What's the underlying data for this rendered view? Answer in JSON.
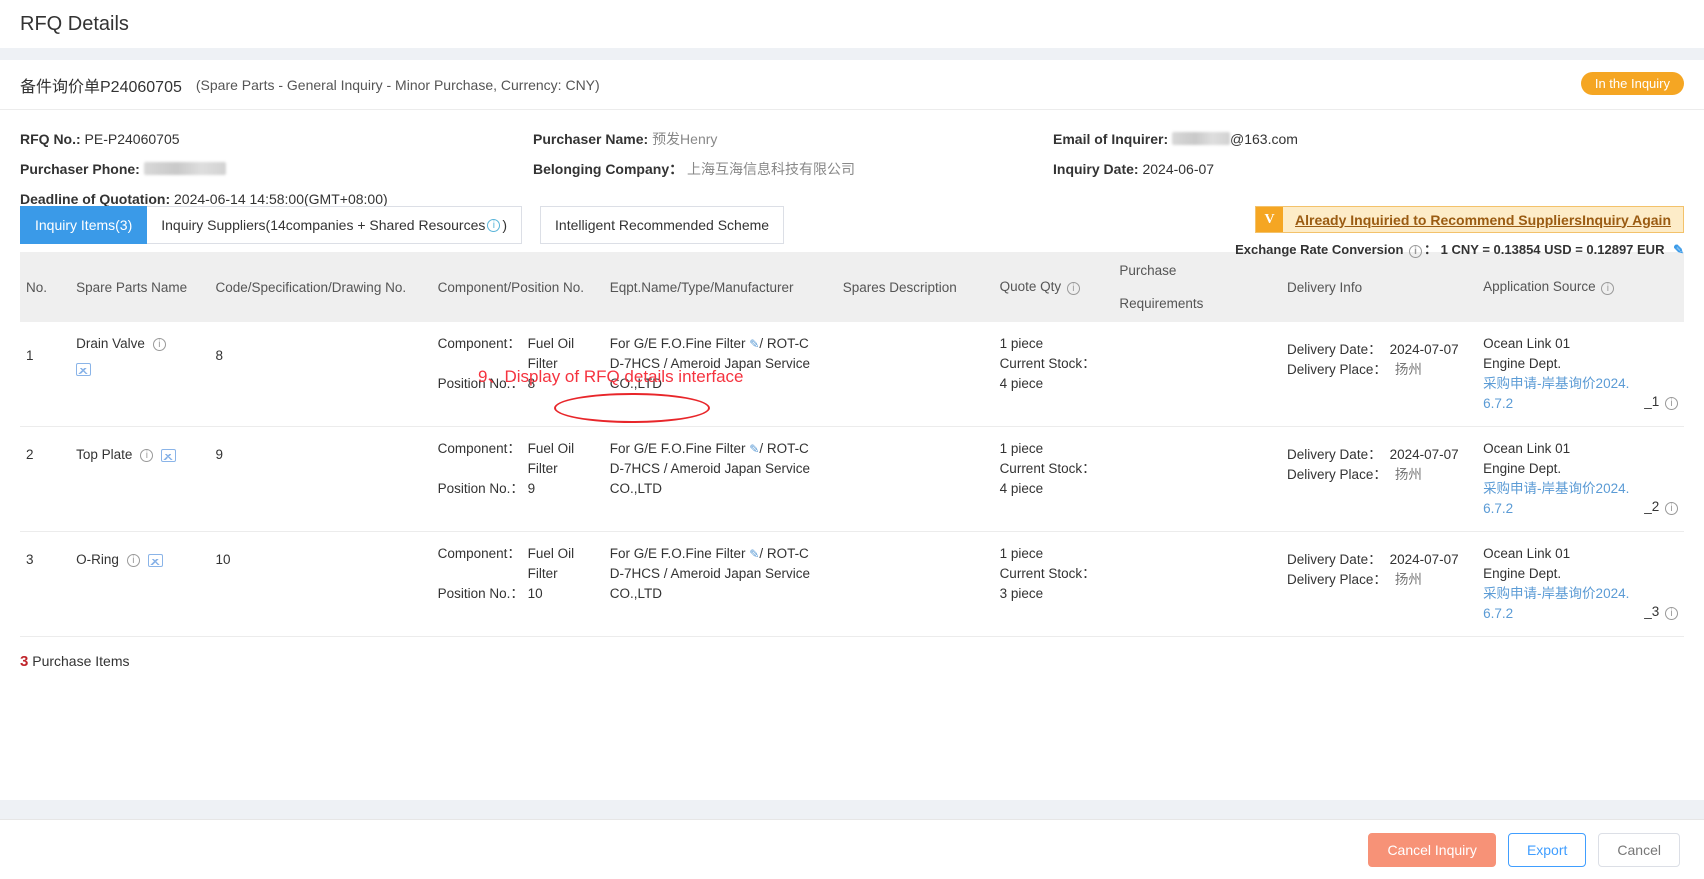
{
  "page": {
    "title": "RFQ Details"
  },
  "order": {
    "number": "备件询价单P24060705",
    "subtitle": "(Spare Parts - General Inquiry - Minor Purchase, Currency: CNY)",
    "status_badge": "In the Inquiry",
    "status_color": "#f5a623"
  },
  "meta": {
    "rfq_no_label": "RFQ No.:",
    "rfq_no_value": "PE-P24060705",
    "purchaser_phone_label": "Purchaser Phone:",
    "purchaser_phone_value": "",
    "deadline_label": "Deadline of Quotation:",
    "deadline_value": "2024-06-14 14:58:00(GMT+08:00)",
    "purchaser_name_label": "Purchaser Name:",
    "purchaser_name_value": "预发Henry",
    "belonging_company_label": "Belonging Company：",
    "belonging_company_value": "上海互海信息科技有限公司",
    "email_label": "Email of Inquirer:",
    "email_value": "@163.com",
    "inquiry_date_label": "Inquiry Date:",
    "inquiry_date_value": "2024-06-07"
  },
  "tabs": [
    {
      "label": "Inquiry Items(3)",
      "active": true
    },
    {
      "label": "Inquiry Suppliers(14companies + Shared Resources",
      "suffix": ")",
      "has_info": true,
      "active": false
    },
    {
      "label": "Intelligent Recommended Scheme",
      "active": false
    }
  ],
  "notice": {
    "badge": "V",
    "text": "Already Inquiried to Recommend SuppliersInquiry Again",
    "bg": "#fdecc8",
    "border": "#f3c26b",
    "badge_bg": "#f5a623"
  },
  "exchange": {
    "label": "Exchange Rate Conversion",
    "separator": "：",
    "value": "1 CNY = 0.13854 USD = 0.12897 EUR",
    "edit_icon": "edit-icon"
  },
  "annotation": {
    "text": "9、Display of RFQ details interface",
    "color": "#f5333f"
  },
  "table": {
    "headers": [
      "No.",
      "Spare Parts Name",
      "Code/Specification/Drawing No.",
      "Component/Position No.",
      "Eqpt.Name/Type/Manufacturer",
      "Spares Description",
      "Quote Qty",
      "Purchase",
      "Requirements",
      "Delivery Info",
      "Application Source"
    ],
    "labels": {
      "component": "Component：",
      "position_no": "Position No.：",
      "current_stock": "Current Stock：",
      "delivery_date": "Delivery Date：",
      "delivery_place": "Delivery Place："
    },
    "rows": [
      {
        "no": "1",
        "name": "Drain Valve",
        "code": "8",
        "component_value": "Fuel Oil Filter",
        "position_no": "8",
        "eqpt_line1": "For G/E F.O.Fine Filter",
        "eqpt_line1_tail": "/ ROT-C",
        "eqpt_line2": "D-7HCS / Ameroid Japan Service",
        "eqpt_line3": "CO.,LTD",
        "description": "",
        "quote_qty": "1 piece",
        "current_stock": "4 piece",
        "purchase_requirements": "",
        "delivery_date": "2024-07-07",
        "delivery_place": "扬州",
        "appl_line1": "Ocean Link 01",
        "appl_line2": "Engine Dept.",
        "appl_link1": "采购申请-岸基询价2024.",
        "appl_link2": "6.7.2",
        "appl_suffix": "_1"
      },
      {
        "no": "2",
        "name": "Top Plate",
        "code": "9",
        "component_value": "Fuel Oil Filter",
        "position_no": "9",
        "eqpt_line1": "For G/E F.O.Fine Filter",
        "eqpt_line1_tail": "/ ROT-C",
        "eqpt_line2": "D-7HCS / Ameroid Japan Service",
        "eqpt_line3": "CO.,LTD",
        "description": "",
        "quote_qty": "1 piece",
        "current_stock": "4 piece",
        "purchase_requirements": "",
        "delivery_date": "2024-07-07",
        "delivery_place": "扬州",
        "appl_line1": "Ocean Link 01",
        "appl_line2": "Engine Dept.",
        "appl_link1": "采购申请-岸基询价2024.",
        "appl_link2": "6.7.2",
        "appl_suffix": "_2"
      },
      {
        "no": "3",
        "name": "O-Ring",
        "code": "10",
        "component_value": "Fuel Oil Filter",
        "position_no": "10",
        "eqpt_line1": "For G/E F.O.Fine Filter",
        "eqpt_line1_tail": "/ ROT-C",
        "eqpt_line2": "D-7HCS / Ameroid Japan Service",
        "eqpt_line3": "CO.,LTD",
        "description": "",
        "quote_qty": "1 piece",
        "current_stock": "3 piece",
        "purchase_requirements": "",
        "delivery_date": "2024-07-07",
        "delivery_place": "扬州",
        "appl_line1": "Ocean Link 01",
        "appl_line2": "Engine Dept.",
        "appl_link1": "采购申请-岸基询价2024.",
        "appl_link2": "6.7.2",
        "appl_suffix": "_3"
      }
    ]
  },
  "summary": {
    "count": "3",
    "label": "Purchase Items"
  },
  "footer": {
    "cancel_inquiry": "Cancel Inquiry",
    "export": "Export",
    "cancel": "Cancel"
  }
}
